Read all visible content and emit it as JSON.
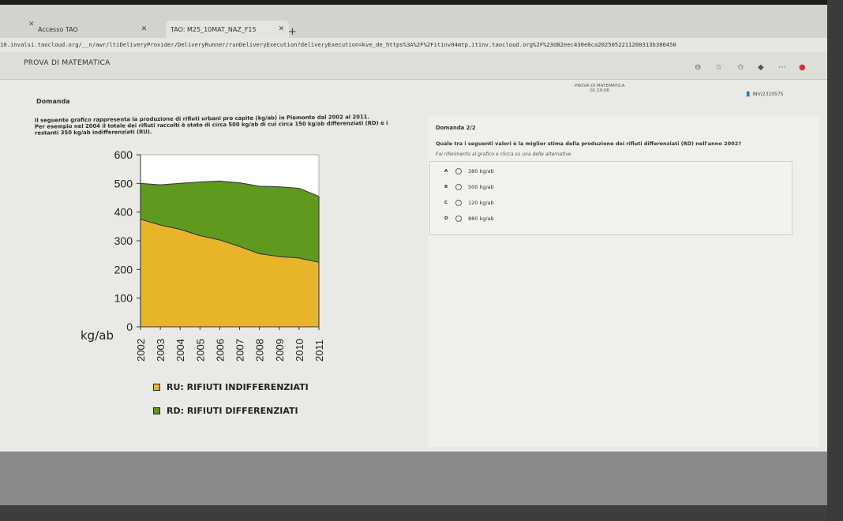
{
  "browser": {
    "tabs": [
      {
        "label": "Accesso TAO"
      },
      {
        "label": "TAO: M25_10MAT_NAZ_F15"
      }
    ],
    "url": "10.invalsi.taocloud.org/__n/awr/ltiDeliveryProvider/DeliveryRunner/runDeliveryExecution?deliveryExecution=kve_de_https%3A%2F%2Fitinv04mtp.itinv.taocloud.org%2F%23d82eec430e0ca2025052211200313b386450"
  },
  "header": {
    "title": "PROVA DI MATEMATICA",
    "center_title": "PROVA DI MATEMATICA",
    "timer": "01:19:06",
    "user": "INV/2310575"
  },
  "left": {
    "domanda_label": "Domanda",
    "stem_line1": "Il seguente grafico rappresenta la produzione di rifiuti urbani pro capite (kg/ab) in Piemonte dal 2002 al 2011.",
    "stem_line2": "Per esempio nel 2004 il totale dei rifiuti raccolti è stato di circa 500 kg/ab di cui circa 150 kg/ab differenziati (RD) e i",
    "stem_line3": "restanti 350 kg/ab indifferenziati (RU)."
  },
  "right": {
    "question_number": "Domanda 2/2",
    "question_text": "Quale tra i seguenti valori è la miglior stima della produzione dei rifiuti differenziati (RD) nell'anno 2002?",
    "hint": "Fai riferimento al grafico e clicca su una delle alternative",
    "options": [
      {
        "letter": "A",
        "text": "380 kg/ab"
      },
      {
        "letter": "B",
        "text": "500 kg/ab"
      },
      {
        "letter": "C",
        "text": "120 kg/ab"
      },
      {
        "letter": "D",
        "text": "880 kg/ab"
      }
    ]
  },
  "chart_data": {
    "type": "area",
    "x": [
      "2002",
      "2003",
      "2004",
      "2005",
      "2006",
      "2007",
      "2008",
      "2009",
      "2010",
      "2011"
    ],
    "series": [
      {
        "name": "RU: RIFIUTI INDIFFERENZIATI",
        "values": [
          375,
          355,
          340,
          318,
          303,
          280,
          255,
          245,
          240,
          225
        ],
        "color": "#e8b52a"
      },
      {
        "name": "RD: RIFIUTI DIFFERENZIATI",
        "values": [
          125,
          140,
          160,
          187,
          205,
          222,
          235,
          243,
          243,
          230
        ],
        "color": "#5f9a1e"
      }
    ],
    "y_ticks": [
      "0",
      "100",
      "200",
      "300",
      "400",
      "500",
      "600"
    ],
    "ylim": [
      0,
      600
    ],
    "ylabel": "kg/ab",
    "stacked": true
  }
}
